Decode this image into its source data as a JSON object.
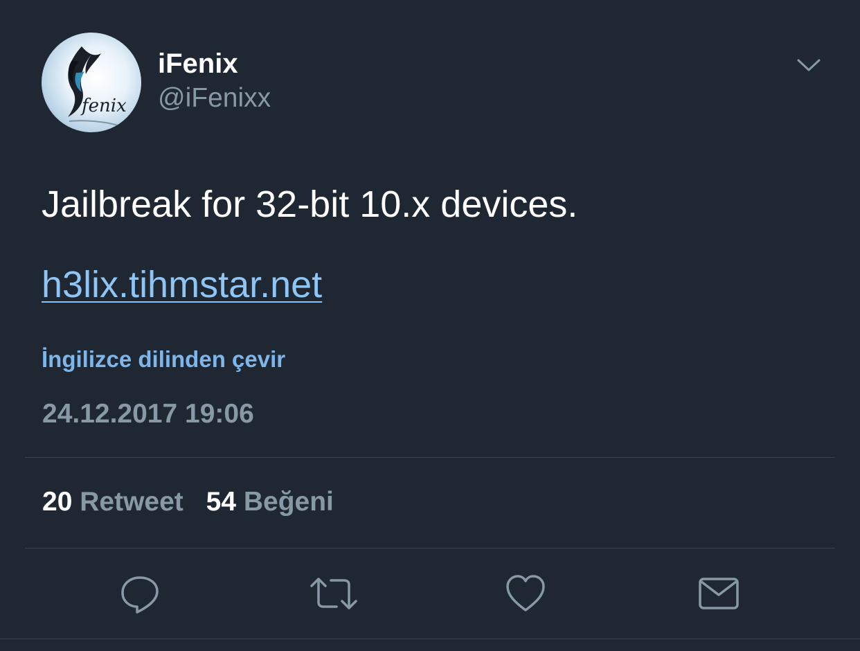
{
  "author": {
    "display_name": "iFenix",
    "handle": "@iFenixx",
    "avatar_text": "fenix"
  },
  "tweet": {
    "text": "Jailbreak for 32-bit 10.x devices.",
    "link": "h3lix.tihmstar.net",
    "translate_label": "İngilizce dilinden çevir",
    "timestamp": "24.12.2017 19:06"
  },
  "stats": {
    "retweet_count": "20",
    "retweet_label": "Retweet",
    "like_count": "54",
    "like_label": "Beğeni"
  },
  "actions": {
    "icons": [
      "reply-icon",
      "retweet-icon",
      "like-icon",
      "direct-message-icon"
    ]
  },
  "colors": {
    "background": "#1f2733",
    "text_primary": "#ffffff",
    "text_secondary": "#8899a6",
    "link": "#8ec5f5",
    "divider": "#38444d"
  }
}
